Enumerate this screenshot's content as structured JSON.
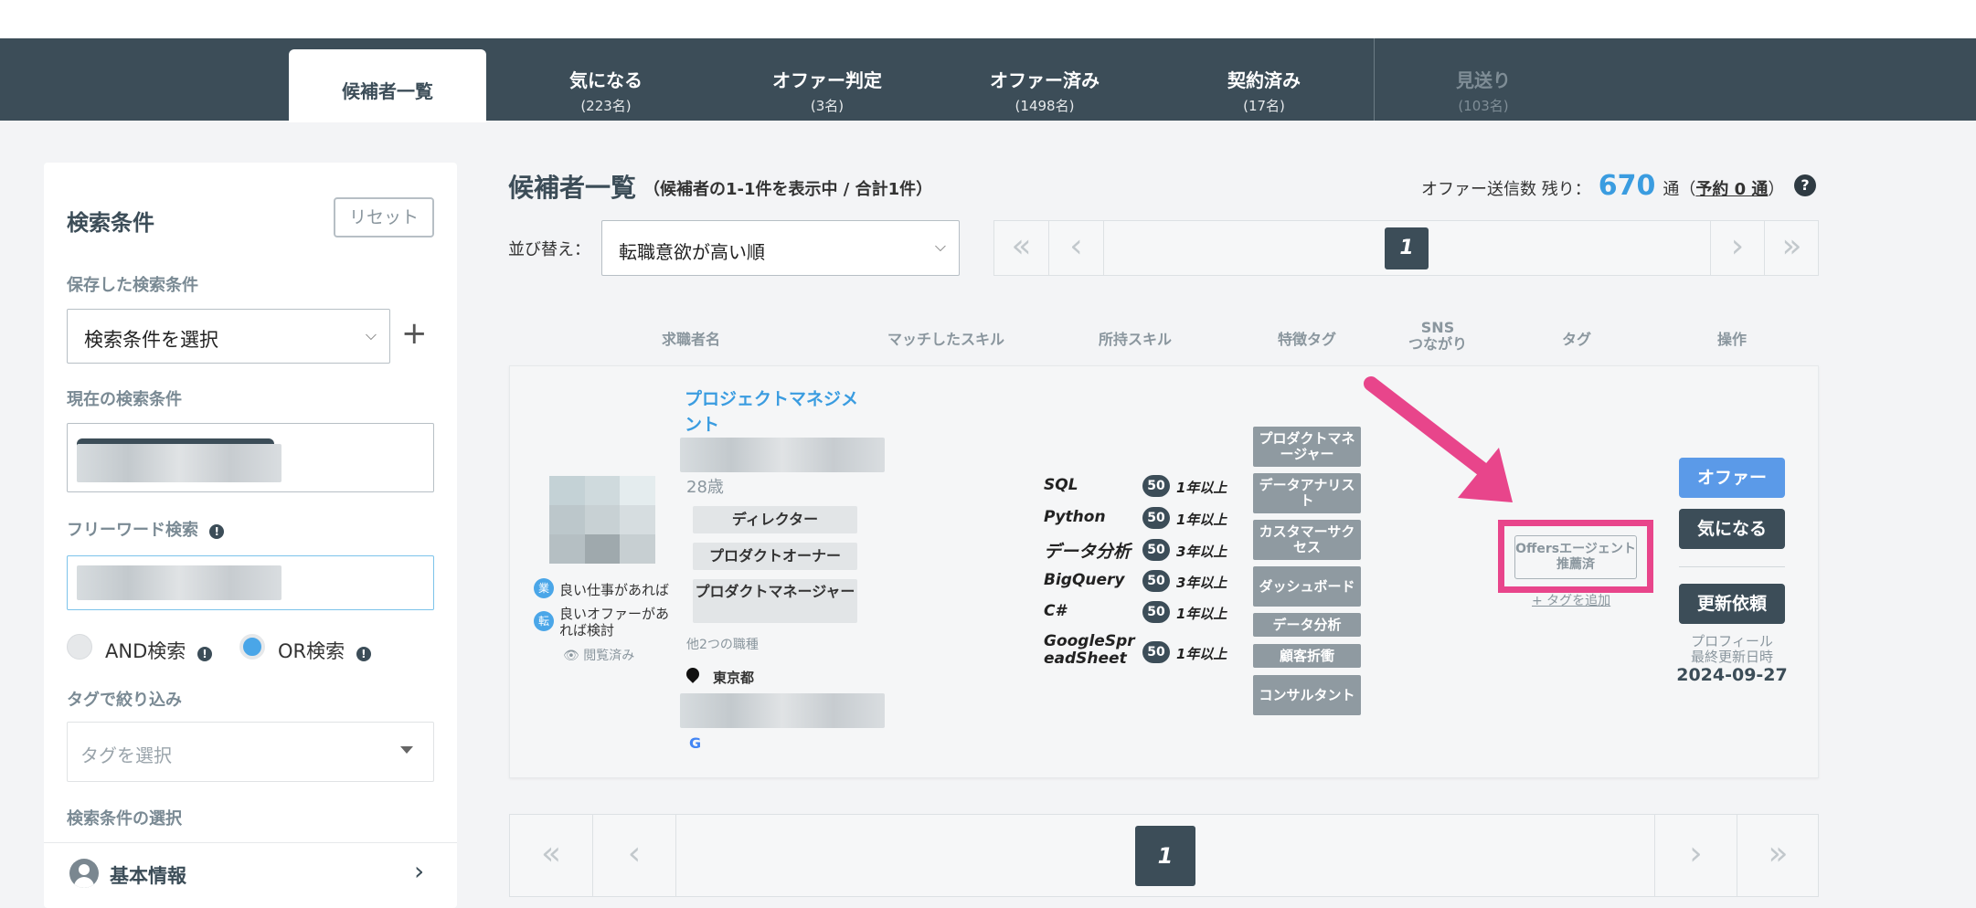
{
  "nav": {
    "tabs": [
      {
        "label": "候補者一覧",
        "count": ""
      },
      {
        "label": "気になる",
        "count": "(223名)"
      },
      {
        "label": "オファー判定",
        "count": "(3名)"
      },
      {
        "label": "オファー済み",
        "count": "(1498名)"
      },
      {
        "label": "契約済み",
        "count": "(17名)"
      },
      {
        "label": "見送り",
        "count": "(103名)"
      }
    ]
  },
  "sidebar": {
    "title": "検索条件",
    "reset_label": "リセット",
    "saved_label": "保存した検索条件",
    "saved_select": "検索条件を選択",
    "add_symbol": "+",
    "current_label": "現在の検索条件",
    "freeword_label": "フリーワード検索",
    "and_label": "AND検索",
    "or_label": "OR検索",
    "tag_filter_label": "タグで絞り込み",
    "tag_placeholder": "タグを選択",
    "condition_select_label": "検索条件の選択",
    "basic_info_label": "基本情報"
  },
  "main": {
    "title": "候補者一覧",
    "subtitle": "（候補者の1-1件を表示中 / 合計1件）",
    "offer_prefix": "オファー送信数 残り：",
    "offer_count": "670",
    "offer_unit": "通",
    "reserve_paren_open": "（",
    "reserve_link": "予約 0 通",
    "reserve_paren_close": "）",
    "help_symbol": "?",
    "sort_label": "並び替え：",
    "sort_value": "転職意欲が高い順",
    "page_current": "1",
    "columns": [
      "求職者名",
      "マッチしたスキル",
      "所持スキル",
      "特徴タグ",
      "SNS\nつながり",
      "タグ",
      "操作"
    ]
  },
  "candidate": {
    "job_title": "プロジェクトマネジメント",
    "age": "28歳",
    "job_tags": [
      "ディレクター",
      "プロダクトオーナー",
      "プロダクトマネージャー"
    ],
    "status_chip1_icon": "業",
    "status_chip1_text": "良い仕事があれば",
    "status_chip2_icon": "転",
    "status_chip2_text": "良いオファーがあれば検討",
    "viewed_label": "閲覧済み",
    "other_jobs": "他2つの職種",
    "location": "東京都",
    "google_glyph": "G",
    "skills": [
      {
        "name": "SQL",
        "level": "50",
        "years": "1年以上"
      },
      {
        "name": "Python",
        "level": "50",
        "years": "1年以上"
      },
      {
        "name": "データ分析",
        "level": "50",
        "years": "3年以上"
      },
      {
        "name": "BigQuery",
        "level": "50",
        "years": "3年以上"
      },
      {
        "name": "C#",
        "level": "50",
        "years": "1年以上"
      },
      {
        "name": "GoogleSpreadSheet",
        "level": "50",
        "years": "1年以上"
      }
    ],
    "feature_tags": [
      "プロダクトマネージャー",
      "データアナリスト",
      "カスタマーサクセス",
      "ダッシュボード",
      "データ分析",
      "顧客折衝",
      "コンサルタント"
    ],
    "agent_tag": "Offersエージェント推薦済",
    "add_tag": "+ タグを追加",
    "offer_btn": "オファー",
    "interest_btn": "気になる",
    "update_btn": "更新依頼",
    "profile_updated_label": "プロフィール\n最終更新日時",
    "profile_updated_date": "2024-09-27"
  },
  "colors": {
    "nav_bg": "#3c4d58",
    "link_blue": "#3a9ce0",
    "offer_btn": "#5b9ae8",
    "highlight_pink": "#e8458b"
  }
}
